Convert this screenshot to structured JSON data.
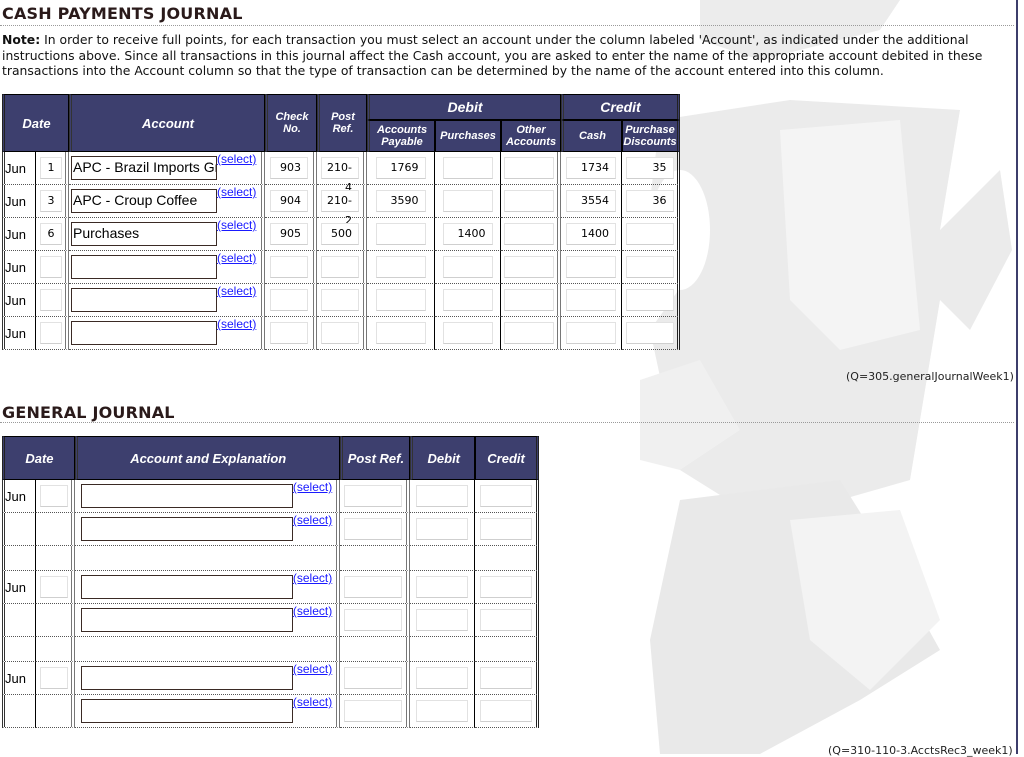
{
  "cash_payments_journal": {
    "title": "CASH PAYMENTS JOURNAL",
    "note_label": "Note:",
    "note_text": " In order to receive full points, for each transaction you must select an account under the column labeled 'Account', as indicated under the additional instructions above. Since all transactions in this journal affect the Cash account, you are asked to enter the name of the appropriate account debited in these transactions into the Account column so that the type of transaction can be determined by the name of the account entered into this column.",
    "headers": {
      "date": "Date",
      "account": "Account",
      "check_no": "Check No.",
      "post_ref": "Post Ref.",
      "debit": "Debit",
      "credit": "Credit",
      "accounts_payable": "Accounts Payable",
      "purchases": "Purchases",
      "other_accounts": "Other Accounts",
      "cash": "Cash",
      "purchase_discounts": "Purchase Discounts"
    },
    "select_label": "(select)",
    "rows": [
      {
        "month": "Jun",
        "day": "1",
        "account": "APC - Brazil Imports Group",
        "check_no": "903",
        "post_ref": "210-4",
        "accounts_payable": "1769",
        "purchases": "",
        "other_accounts": "",
        "cash": "1734",
        "purchase_discounts": "35"
      },
      {
        "month": "Jun",
        "day": "3",
        "account": "APC - Croup Coffee",
        "check_no": "904",
        "post_ref": "210-2",
        "accounts_payable": "3590",
        "purchases": "",
        "other_accounts": "",
        "cash": "3554",
        "purchase_discounts": "36"
      },
      {
        "month": "Jun",
        "day": "6",
        "account": "Purchases",
        "check_no": "905",
        "post_ref": "500",
        "accounts_payable": "",
        "purchases": "1400",
        "other_accounts": "",
        "cash": "1400",
        "purchase_discounts": ""
      },
      {
        "month": "Jun",
        "day": "",
        "account": "",
        "check_no": "",
        "post_ref": "",
        "accounts_payable": "",
        "purchases": "",
        "other_accounts": "",
        "cash": "",
        "purchase_discounts": ""
      },
      {
        "month": "Jun",
        "day": "",
        "account": "",
        "check_no": "",
        "post_ref": "",
        "accounts_payable": "",
        "purchases": "",
        "other_accounts": "",
        "cash": "",
        "purchase_discounts": ""
      },
      {
        "month": "Jun",
        "day": "",
        "account": "",
        "check_no": "",
        "post_ref": "",
        "accounts_payable": "",
        "purchases": "",
        "other_accounts": "",
        "cash": "",
        "purchase_discounts": ""
      }
    ],
    "question_ref": "(Q=305.generalJournalWeek1)"
  },
  "general_journal": {
    "title": "GENERAL JOURNAL",
    "headers": {
      "date": "Date",
      "account_explanation": "Account and Explanation",
      "post_ref": "Post Ref.",
      "debit": "Debit",
      "credit": "Credit"
    },
    "select_label": "(select)",
    "entries": [
      {
        "month": "Jun",
        "day": "",
        "lines": [
          {
            "account": "",
            "post_ref": "",
            "debit": "",
            "credit": ""
          },
          {
            "account": "",
            "post_ref": "",
            "debit": "",
            "credit": ""
          }
        ]
      },
      {
        "month": "Jun",
        "day": "",
        "lines": [
          {
            "account": "",
            "post_ref": "",
            "debit": "",
            "credit": ""
          },
          {
            "account": "",
            "post_ref": "",
            "debit": "",
            "credit": ""
          }
        ]
      },
      {
        "month": "Jun",
        "day": "",
        "lines": [
          {
            "account": "",
            "post_ref": "",
            "debit": "",
            "credit": ""
          },
          {
            "account": "",
            "post_ref": "",
            "debit": "",
            "credit": ""
          }
        ]
      }
    ],
    "question_ref": "(Q=310-110-3.AcctsRec3_week1)"
  }
}
